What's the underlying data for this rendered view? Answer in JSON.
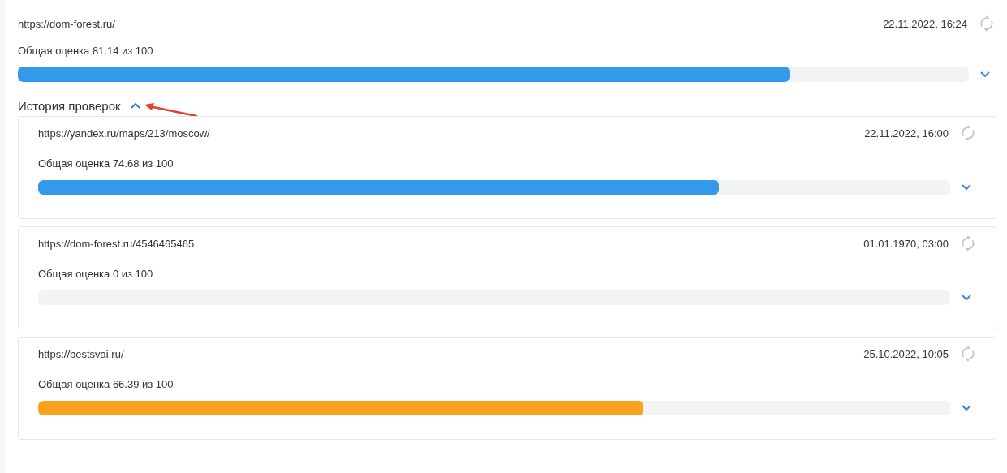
{
  "current": {
    "url": "https://dom-forest.ru/",
    "date": "22.11.2022, 16:24",
    "score": "Общая оценка 81.14 из 100",
    "level": 0.8114,
    "color": "#3399ea",
    "expanded": false
  },
  "history": {
    "title": "История проверок",
    "expanded": true,
    "items": [
      {
        "url": "https://yandex.ru/maps/213/moscow/",
        "date": "22.11.2022, 16:00",
        "score": "Общая оценка 74.68 из 100",
        "level": 0.7468,
        "color": "#3399ea",
        "expanded": false
      },
      {
        "url": "https://dom-forest.ru/4546465465",
        "date": "01.01.1970, 03:00",
        "score": "Общая оценка 0 из 100",
        "expanded": false
      },
      {
        "url": "https://bestsvai.ru/",
        "date": "25.10.2022, 10:05",
        "score": "Общая оценка 66.39 из 100",
        "level": 0.6639,
        "color": "#fba31f",
        "expanded": false
      }
    ]
  }
}
